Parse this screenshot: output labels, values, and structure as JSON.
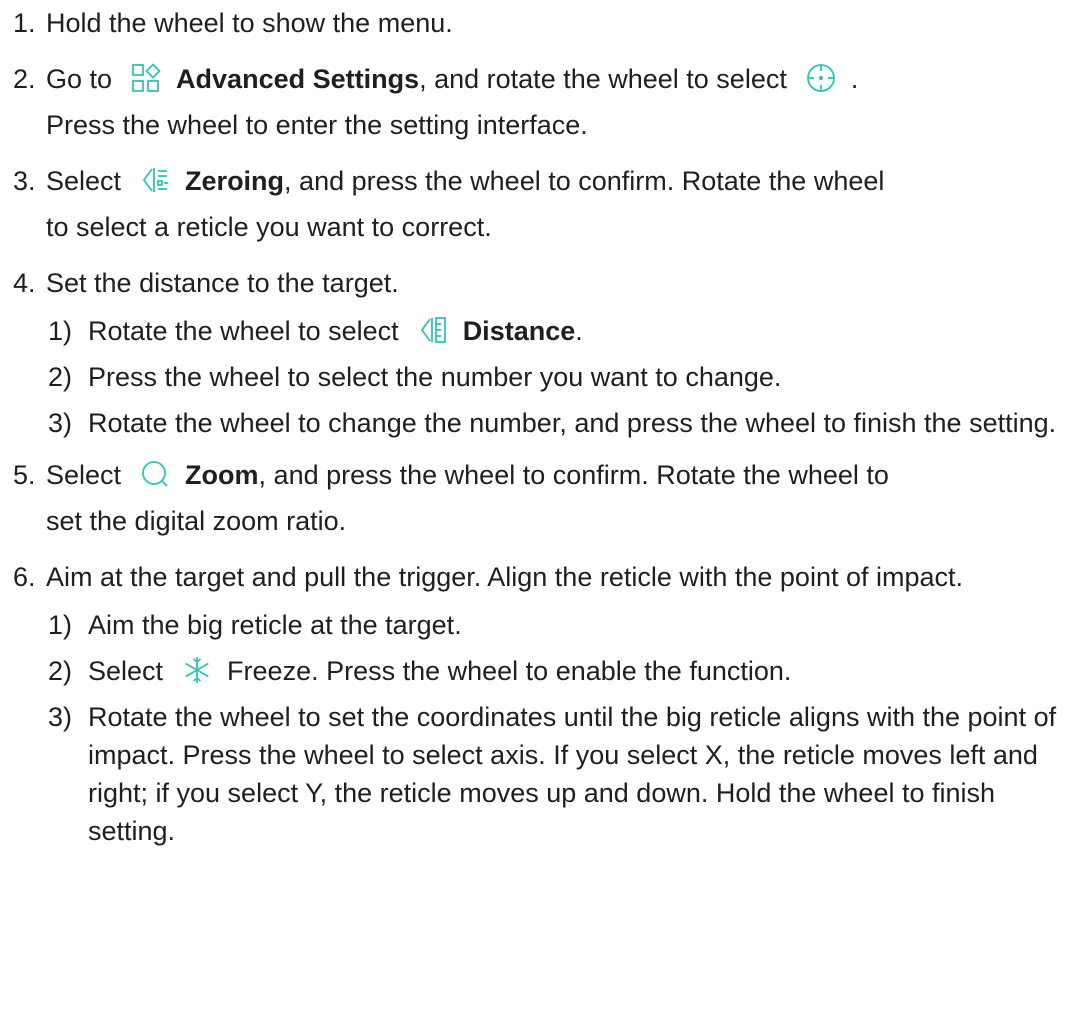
{
  "colors": {
    "text": "#1f1f1f",
    "icon_accent": "#2ec4b6"
  },
  "steps": [
    {
      "num": "1.",
      "text": "Hold the wheel to show the menu."
    },
    {
      "num": "2.",
      "pre": "Go to",
      "icon": "advanced-settings-icon",
      "bold": "Advanced Settings",
      "mid": ", and rotate the wheel to select",
      "icon2": "reticle-crosshair-icon",
      "post": ".",
      "line2": "Press the wheel to enter the setting interface."
    },
    {
      "num": "3.",
      "pre": "Select",
      "icon": "zeroing-icon",
      "bold": "Zeroing",
      "post": ", and press the wheel to confirm. Rotate the wheel",
      "line2": "to select a reticle you want to correct."
    },
    {
      "num": "4.",
      "text": "Set the distance to the target.",
      "subs": [
        {
          "num": "1)",
          "pre": "Rotate the wheel to select",
          "icon": "distance-icon",
          "bold": "Distance",
          "post": "."
        },
        {
          "num": "2)",
          "text": "Press the wheel to select the number you want to change."
        },
        {
          "num": "3)",
          "text": "Rotate the wheel to change the number, and press the wheel to finish the setting."
        }
      ]
    },
    {
      "num": "5.",
      "pre": "Select",
      "icon": "zoom-icon",
      "bold": "Zoom",
      "post": ", and press the wheel to confirm. Rotate the wheel to",
      "line2": "set the digital zoom ratio."
    },
    {
      "num": "6.",
      "text": "Aim at the target and pull the trigger. Align the reticle with the point of impact.",
      "subs": [
        {
          "num": "1)",
          "text": "Aim the big reticle at the target."
        },
        {
          "num": "2)",
          "pre": "Select",
          "icon": "freeze-icon",
          "post": "Freeze. Press the wheel to enable the function."
        },
        {
          "num": "3)",
          "text": "Rotate the wheel to set the coordinates until the big reticle aligns with the point of impact. Press the wheel to select axis. If you select X, the reticle moves left and right; if you select Y, the reticle moves up and down. Hold the wheel to finish setting."
        }
      ]
    }
  ]
}
